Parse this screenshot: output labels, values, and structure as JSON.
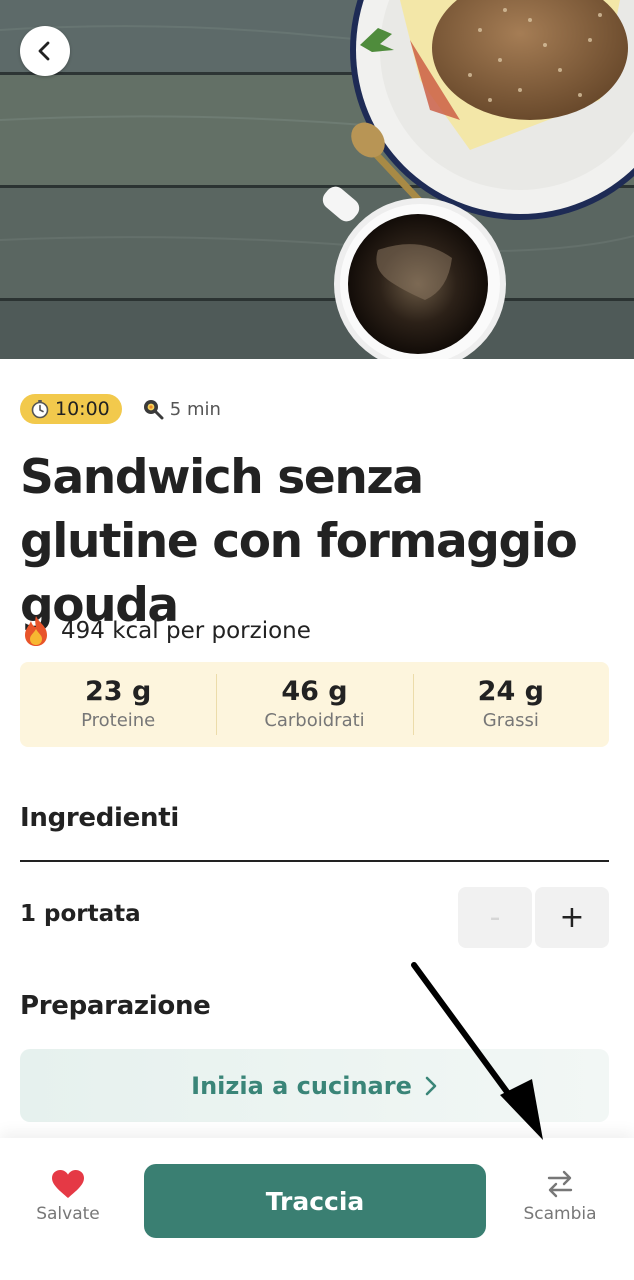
{
  "hero": {
    "back_icon": "chevron-left-icon"
  },
  "meta": {
    "time_badge": "10:00",
    "time_icon": "alarm-clock-icon",
    "prep_time": "5 min",
    "prep_icon": "frying-pan-icon"
  },
  "recipe": {
    "title": "Sandwich senza glutine con formaggio gouda",
    "calories_text": "494 kcal per porzione",
    "calories_icon": "fire-icon"
  },
  "macros": [
    {
      "value": "23 g",
      "label": "Proteine"
    },
    {
      "value": "46 g",
      "label": "Carboidrati"
    },
    {
      "value": "24 g",
      "label": "Grassi"
    }
  ],
  "ingredients": {
    "heading": "Ingredienti",
    "servings": "1 portata",
    "minus": "-",
    "plus": "+"
  },
  "preparation": {
    "heading": "Preparazione",
    "cook_button": "Inizia a cucinare"
  },
  "bottom_bar": {
    "saved_label": "Salvate",
    "track_label": "Traccia",
    "swap_label": "Scambia"
  },
  "colors": {
    "accent": "#3a7f72",
    "badge": "#f2c94c",
    "macro_bg": "#fdf5dd",
    "heart": "#e53945"
  }
}
